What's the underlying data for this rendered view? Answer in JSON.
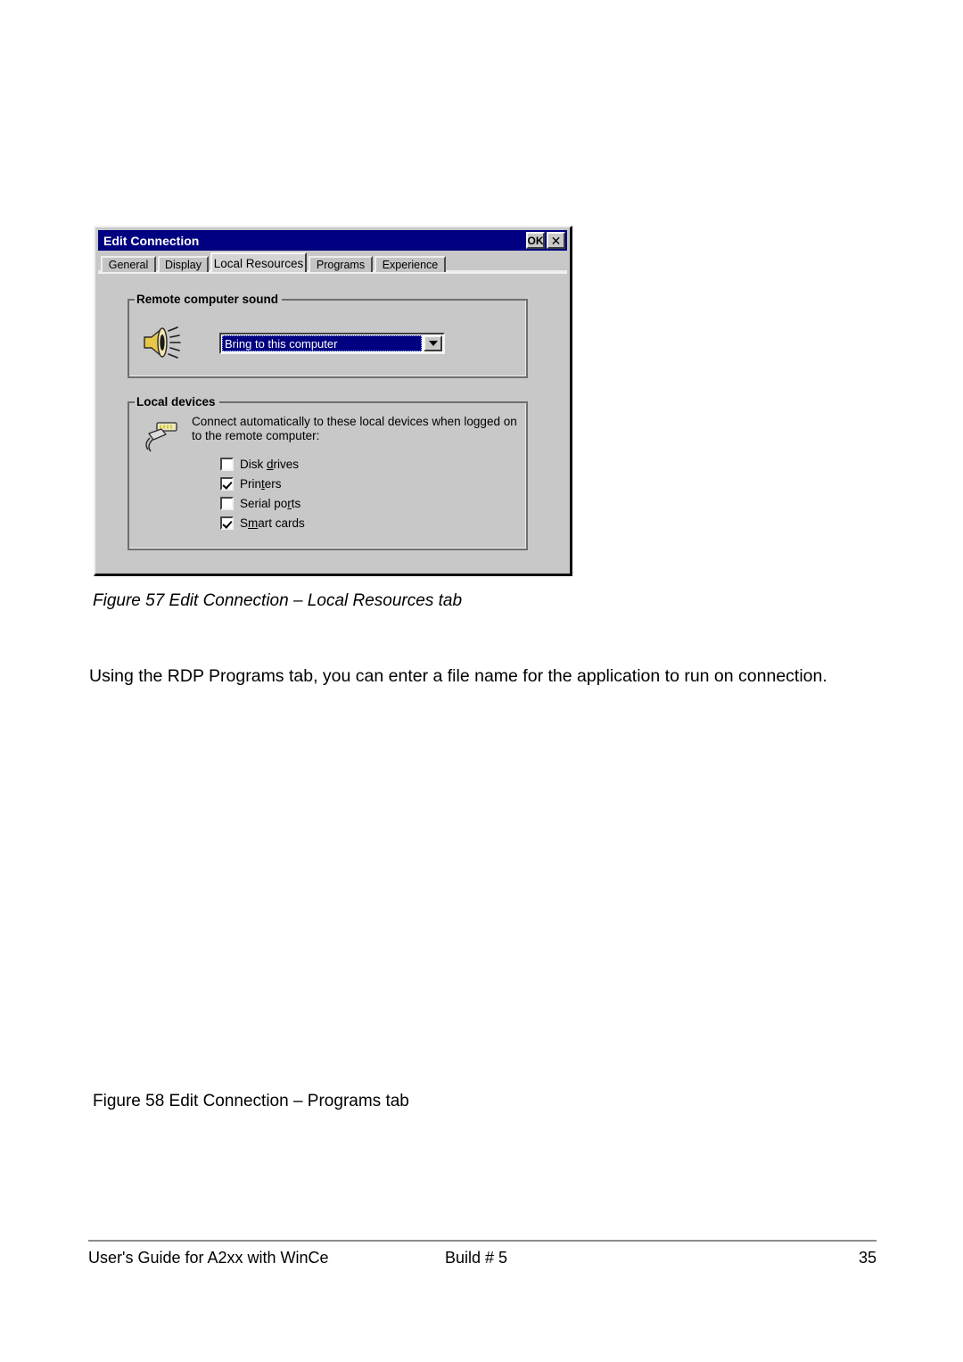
{
  "document": {
    "paragraph": "Using the RDP Programs tab, you can enter a file name for the application to run on connection.",
    "caption_57": "Figure 57 Edit Connection – Local Resources tab",
    "caption_58": "Figure 58 Edit Connection – Programs tab"
  },
  "footer": {
    "left": "User's Guide for A2xx with WinCe",
    "middle": "Build # 5",
    "page_number": "35"
  },
  "dialog": {
    "title": "Edit Connection",
    "buttons": {
      "ok": "OK",
      "close": "✕"
    },
    "tabs": [
      {
        "label": "General",
        "active": false
      },
      {
        "label": "Display",
        "active": false
      },
      {
        "label": "Local Resources",
        "active": true
      },
      {
        "label": "Programs",
        "active": false
      },
      {
        "label": "Experience",
        "active": false
      }
    ],
    "sound_group": {
      "title": "Remote computer sound",
      "icon": "speaker-icon",
      "selected_option": "Bring to this computer"
    },
    "devices_group": {
      "title": "Local devices",
      "icon": "plug-icon",
      "description": "Connect automatically to these local devices when logged on to the remote computer:",
      "checkboxes": [
        {
          "label": "Disk drives",
          "pre": "Disk ",
          "acc": "d",
          "post": "rives",
          "checked": false
        },
        {
          "label": "Printers",
          "pre": "Prin",
          "acc": "t",
          "post": "ers",
          "checked": true
        },
        {
          "label": "Serial ports",
          "pre": "Serial po",
          "acc": "r",
          "post": "ts",
          "checked": false
        },
        {
          "label": "Smart cards",
          "pre": "S",
          "acc": "m",
          "post": "art cards",
          "checked": true
        }
      ]
    }
  },
  "colors": {
    "titlebar": "#000080",
    "dialog_face": "#c8c8c8",
    "selection": "#000080",
    "speaker_gold": "#e8c84a",
    "plug_gray": "#d8d8d8"
  }
}
